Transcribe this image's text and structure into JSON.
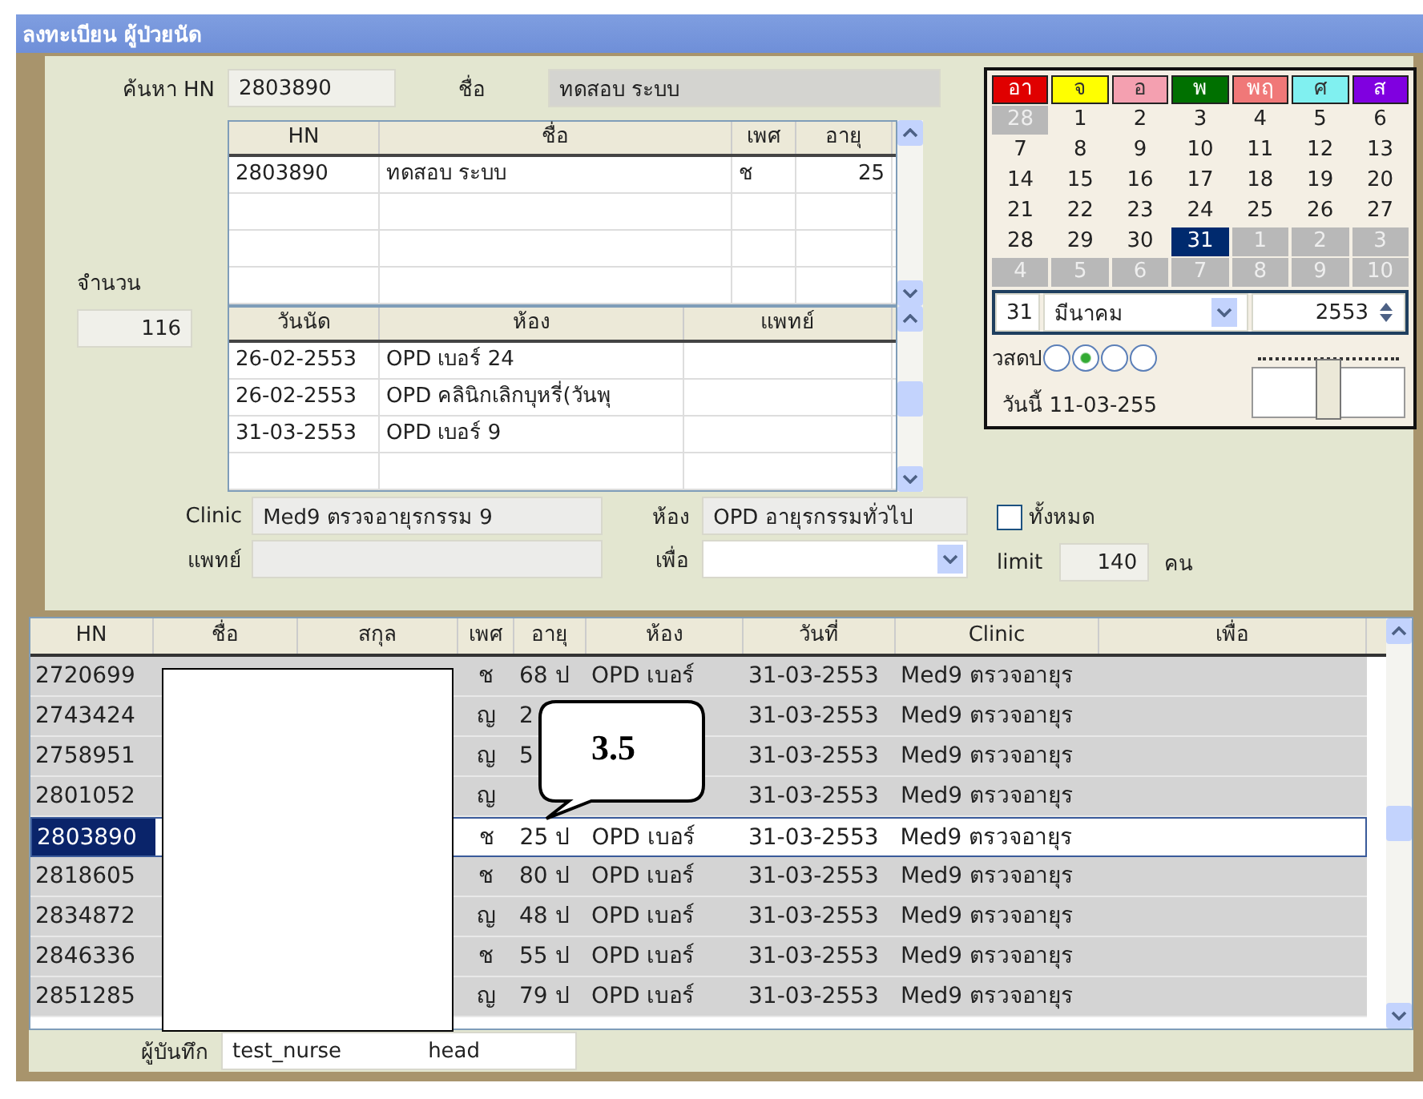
{
  "window": {
    "title": "ลงทะเบียน ผู้ป่วยนัด"
  },
  "search": {
    "hn_label": "ค้นหา HN",
    "hn_value": "2803890",
    "name_label": "ชื่อ",
    "name_value": "ทดสอบ ระบบ"
  },
  "count": {
    "label": "จำนวน",
    "value": "116"
  },
  "patients": {
    "columns": [
      "HN",
      "ชื่อ",
      "เพศ",
      "อายุ"
    ],
    "rows": [
      [
        "2803890",
        "ทดสอบ ระบบ",
        "ช",
        "25"
      ]
    ]
  },
  "appointments": {
    "columns": [
      "วันนัด",
      "ห้อง",
      "แพทย์"
    ],
    "rows": [
      [
        "26-02-2553",
        "OPD เบอร์ 24"
      ],
      [
        "26-02-2553",
        "OPD คลินิกเลิกบุหรี่(วันพุ"
      ],
      [
        "31-03-2553",
        "OPD เบอร์ 9"
      ]
    ]
  },
  "details": {
    "clinic_label": "Clinic",
    "clinic_value": "Med9 ตรวจอายุรกรรม 9",
    "room_label": "ห้อง",
    "room_value": "OPD อายุรกรรมทั่วไป",
    "doctor_label": "แพทย์",
    "purpose_label": "เพื่อ"
  },
  "calendar": {
    "weekdays": [
      {
        "label": "อา",
        "color": "#e00000"
      },
      {
        "label": "จ",
        "color": "#ffff00"
      },
      {
        "label": "อ",
        "color": "#f4a0b0"
      },
      {
        "label": "พ",
        "color": "#007000"
      },
      {
        "label": "พฤ",
        "color": "#f07878"
      },
      {
        "label": "ศ",
        "color": "#80f0f0"
      },
      {
        "label": "ส",
        "color": "#8000e0"
      }
    ],
    "days": [
      {
        "label": "28",
        "muted": true,
        "selected": false
      },
      {
        "label": "1",
        "muted": false,
        "selected": false
      },
      {
        "label": "2",
        "muted": false,
        "selected": false
      },
      {
        "label": "3",
        "muted": false,
        "selected": false
      },
      {
        "label": "4",
        "muted": false,
        "selected": false
      },
      {
        "label": "5",
        "muted": false,
        "selected": false
      },
      {
        "label": "6",
        "muted": false,
        "selected": false
      },
      {
        "label": "7",
        "muted": false,
        "selected": false
      },
      {
        "label": "8",
        "muted": false,
        "selected": false
      },
      {
        "label": "9",
        "muted": false,
        "selected": false
      },
      {
        "label": "10",
        "muted": false,
        "selected": false
      },
      {
        "label": "11",
        "muted": false,
        "selected": false
      },
      {
        "label": "12",
        "muted": false,
        "selected": false
      },
      {
        "label": "13",
        "muted": false,
        "selected": false
      },
      {
        "label": "14",
        "muted": false,
        "selected": false
      },
      {
        "label": "15",
        "muted": false,
        "selected": false
      },
      {
        "label": "16",
        "muted": false,
        "selected": false
      },
      {
        "label": "17",
        "muted": false,
        "selected": false
      },
      {
        "label": "18",
        "muted": false,
        "selected": false
      },
      {
        "label": "19",
        "muted": false,
        "selected": false
      },
      {
        "label": "20",
        "muted": false,
        "selected": false
      },
      {
        "label": "21",
        "muted": false,
        "selected": false
      },
      {
        "label": "22",
        "muted": false,
        "selected": false
      },
      {
        "label": "23",
        "muted": false,
        "selected": false
      },
      {
        "label": "24",
        "muted": false,
        "selected": false
      },
      {
        "label": "25",
        "muted": false,
        "selected": false
      },
      {
        "label": "26",
        "muted": false,
        "selected": false
      },
      {
        "label": "27",
        "muted": false,
        "selected": false
      },
      {
        "label": "28",
        "muted": false,
        "selected": false
      },
      {
        "label": "29",
        "muted": false,
        "selected": false
      },
      {
        "label": "30",
        "muted": false,
        "selected": false
      },
      {
        "label": "31",
        "muted": false,
        "selected": true
      },
      {
        "label": "1",
        "muted": true,
        "selected": false
      },
      {
        "label": "2",
        "muted": true,
        "selected": false
      },
      {
        "label": "3",
        "muted": true,
        "selected": false
      },
      {
        "label": "4",
        "muted": true,
        "selected": false
      },
      {
        "label": "5",
        "muted": true,
        "selected": false
      },
      {
        "label": "6",
        "muted": true,
        "selected": false
      },
      {
        "label": "7",
        "muted": true,
        "selected": false
      },
      {
        "label": "8",
        "muted": true,
        "selected": false
      },
      {
        "label": "9",
        "muted": true,
        "selected": false
      },
      {
        "label": "10",
        "muted": true,
        "selected": false
      }
    ],
    "day_value": "31",
    "month": "มีนาคม",
    "year": "2553",
    "mode_label": "วสดป",
    "modes": [
      {
        "selected": false
      },
      {
        "selected": true
      },
      {
        "selected": false
      },
      {
        "selected": false
      }
    ],
    "slider": {
      "level": 0.5
    },
    "today": "วันนี้ 11-03-255"
  },
  "all_checkbox": {
    "label": "ทั้งหมด",
    "checked": false
  },
  "limit": {
    "label": "limit",
    "value": "140",
    "unit": "คน"
  },
  "grid": {
    "columns": [
      "HN",
      "ชื่อ",
      "สกุล",
      "เพศ",
      "อายุ",
      "ห้อง",
      "วันที่",
      "Clinic",
      "เพื่อ"
    ],
    "rows": [
      {
        "hn": "2720699",
        "sex": "ช",
        "age": "68 ป",
        "room": "OPD เบอร์",
        "date": "31-03-2553",
        "clinic": "Med9 ตรวจอายุร",
        "selected": false
      },
      {
        "hn": "2743424",
        "sex": "ญ",
        "age": "2",
        "date": "31-03-2553",
        "clinic": "Med9 ตรวจอายุร",
        "selected": false
      },
      {
        "hn": "2758951",
        "sex": "ญ",
        "age": "5",
        "date": "31-03-2553",
        "clinic": "Med9 ตรวจอายุร",
        "selected": false
      },
      {
        "hn": "2801052",
        "sex": "ญ",
        "date": "31-03-2553",
        "clinic": "Med9 ตรวจอายุร",
        "selected": false
      },
      {
        "hn": "2803890",
        "sex": "ช",
        "age": "25 ป",
        "room": "OPD เบอร์",
        "date": "31-03-2553",
        "clinic": "Med9 ตรวจอายุร",
        "selected": true
      },
      {
        "hn": "2818605",
        "sex": "ช",
        "age": "80 ป",
        "room": "OPD เบอร์",
        "date": "31-03-2553",
        "clinic": "Med9 ตรวจอายุร",
        "selected": false
      },
      {
        "hn": "2834872",
        "sex": "ญ",
        "age": "48 ป",
        "room": "OPD เบอร์",
        "date": "31-03-2553",
        "clinic": "Med9 ตรวจอายุร",
        "selected": false
      },
      {
        "hn": "2846336",
        "sex": "ช",
        "age": "55 ป",
        "room": "OPD เบอร์",
        "date": "31-03-2553",
        "clinic": "Med9 ตรวจอายุร",
        "selected": false
      },
      {
        "hn": "2851285",
        "sex": "ญ",
        "age": "79 ป",
        "room": "OPD เบอร์",
        "date": "31-03-2553",
        "clinic": "Med9 ตรวจอายุร",
        "selected": false
      }
    ]
  },
  "recorder": {
    "label": "ผู้บันทึก",
    "user": "test_nurse",
    "role": "head"
  },
  "callout": {
    "text": "3.5"
  }
}
